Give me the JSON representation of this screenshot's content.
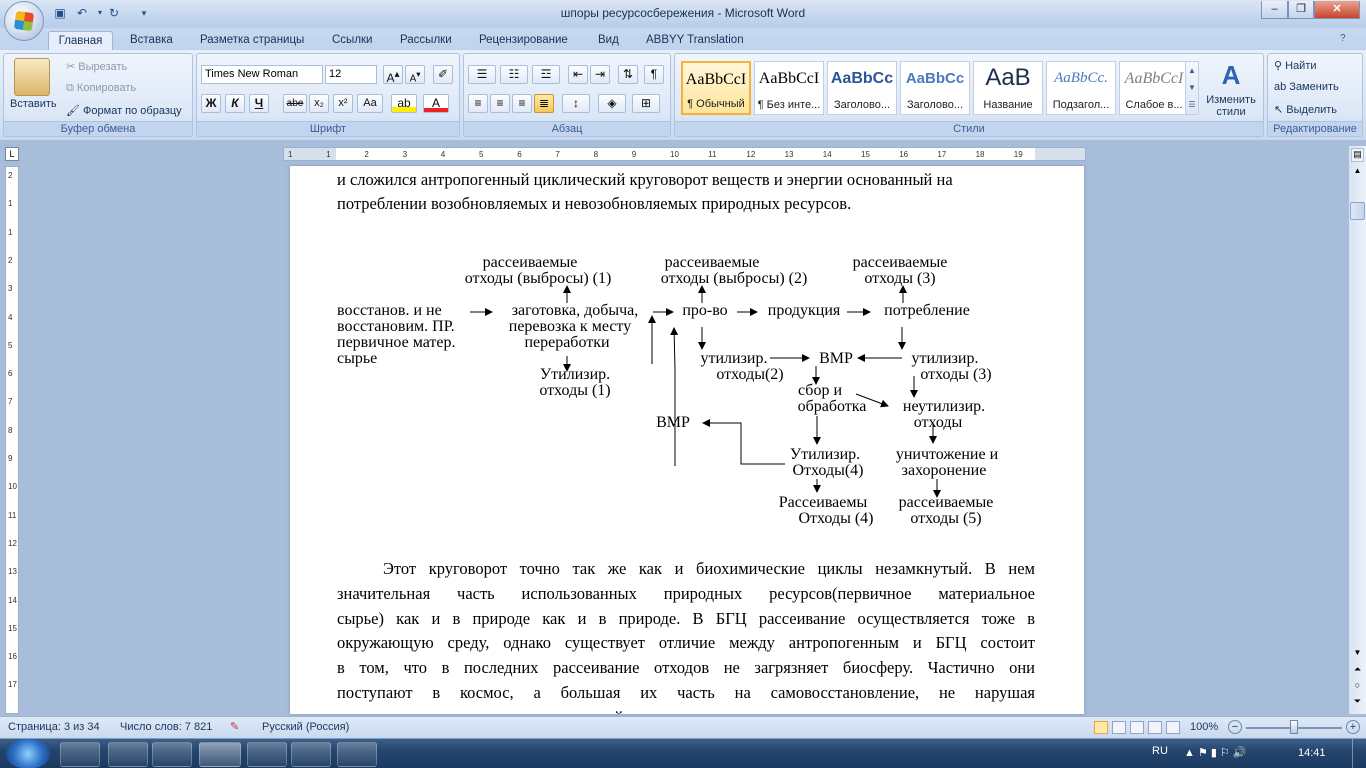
{
  "window": {
    "title": "шпоры ресурсосбережения - Microsoft Word"
  },
  "tabs": [
    "Главная",
    "Вставка",
    "Разметка страницы",
    "Ссылки",
    "Рассылки",
    "Рецензирование",
    "Вид",
    "ABBYY Translation"
  ],
  "clipboard": {
    "paste": "Вставить",
    "cut": "Вырезать",
    "copy": "Копировать",
    "format_painter": "Формат по образцу",
    "label": "Буфер обмена"
  },
  "font": {
    "name": "Times New Roman",
    "size": "12",
    "label": "Шрифт",
    "bold": "Ж",
    "italic": "К",
    "underline": "Ч",
    "strike": "abe",
    "sub": "x₂",
    "sup": "x²",
    "case": "Aa"
  },
  "paragraph": {
    "label": "Абзац"
  },
  "styles": {
    "label": "Стили",
    "items": [
      {
        "sample": "AaBbCcI",
        "name": "¶ Обычный"
      },
      {
        "sample": "AaBbCcI",
        "name": "¶ Без инте..."
      },
      {
        "sample": "AaBbCc",
        "name": "Заголово..."
      },
      {
        "sample": "AaBbCc",
        "name": "Заголово..."
      },
      {
        "sample": "AaB",
        "name": "Название"
      },
      {
        "sample": "AaBbCc.",
        "name": "Подзагол..."
      },
      {
        "sample": "AaBbCcI",
        "name": "Слабое в..."
      }
    ],
    "change": "Изменить стили"
  },
  "editing": {
    "find": "Найти",
    "replace": "Заменить",
    "select": "Выделить",
    "label": "Редактирование"
  },
  "ruler": {
    "marks": [
      "1",
      "1",
      "2",
      "3",
      "4",
      "5",
      "6",
      "7",
      "8",
      "9",
      "10",
      "11",
      "12",
      "13",
      "14",
      "15",
      "16",
      "17",
      "18",
      "19"
    ],
    "vmarks": [
      "2",
      "1",
      "1",
      "2",
      "3",
      "4",
      "5",
      "6",
      "7",
      "8",
      "9",
      "10",
      "11",
      "12",
      "13",
      "14",
      "15",
      "16",
      "17"
    ]
  },
  "doc": {
    "intro": [
      "и сложился антропогенный циклический круговорот веществ и энергии основанный на",
      "потреблении возобновляемых и невозобновляемых природных ресурсов."
    ],
    "diagram": {
      "top1": [
        "рассеиваемые",
        "отходы (выбросы) (1)"
      ],
      "top2": [
        "рассеиваемые",
        "отходы (выбросы) (2)"
      ],
      "top3": [
        "рассеиваемые",
        "отходы (3)"
      ],
      "source": [
        "восстанов. и не",
        "восстановим. ПР.",
        "первичное матер.",
        "сырье"
      ],
      "harvest": [
        "заготовка, добыча,",
        "перевозка к месту",
        "переработки"
      ],
      "production": "про-во",
      "product": "продукция",
      "consumption": "потребление",
      "util1": [
        "Утилизир.",
        "отходы (1)"
      ],
      "util2": [
        "утилизир.",
        "отходы(2)"
      ],
      "vmr1": "ВМР",
      "util3": [
        "утилизир.",
        "отходы (3)"
      ],
      "collect": [
        "сбор и",
        "обработка"
      ],
      "nonutil": [
        "неутилизир.",
        "отходы"
      ],
      "vmr2": "ВМР",
      "util4": [
        "Утилизир.",
        "Отходы(4)"
      ],
      "destroy": [
        "уничтожение и",
        "захоронение"
      ],
      "scatter4": [
        "Рассеиваемы",
        "Отходы (4)"
      ],
      "scatter5": [
        "рассеиваемые",
        "отходы (5)"
      ]
    },
    "body": [
      "Этот круговорот точно так же как и биохимические циклы незамкнутый. В нем",
      "значительная часть использованных природных ресурсов(первичное материальное",
      "сырье) как и в природе как и в природе. В БГЦ рассеивание осуществляется тоже в",
      "окружающую среду, однако существует отличие между антропогенным и БГЦ состоит",
      "в том, что в последних рассеивание отходов не загрязняет биосферу. Частично они",
      "поступают в космос, а большая их часть на самовосстановление, не нарушая",
      "динамического равновесия окружающей среды."
    ]
  },
  "status": {
    "page": "Страница: 3 из 34",
    "words": "Число слов: 7 821",
    "lang": "Русский (Россия)",
    "zoom": "100%"
  },
  "taskbar": {
    "lang": "RU",
    "time": "14:41"
  }
}
